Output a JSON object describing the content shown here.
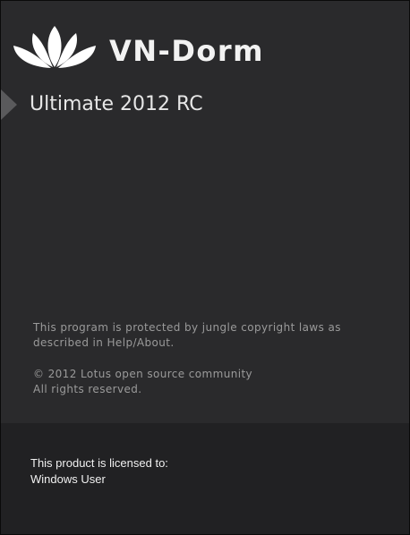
{
  "brand": {
    "name": "VN-Dorm",
    "logo_icon": "lotus-flower-icon"
  },
  "edition": {
    "title": "Ultimate 2012 RC",
    "marker_icon": "triangle-right-icon"
  },
  "notices": {
    "copyright_line1": "This program is protected by jungle copyright laws as",
    "copyright_line2": "described in Help/About.",
    "owner_line1": "© 2012 Lotus open source community",
    "owner_line2": "All rights reserved."
  },
  "license": {
    "label": "This product is licensed to:",
    "user": "Windows User"
  },
  "colors": {
    "background": "#2a2a2c",
    "footer": "#212123",
    "brand_text": "#f2f2f2",
    "notice_text": "#9a9a9a"
  }
}
